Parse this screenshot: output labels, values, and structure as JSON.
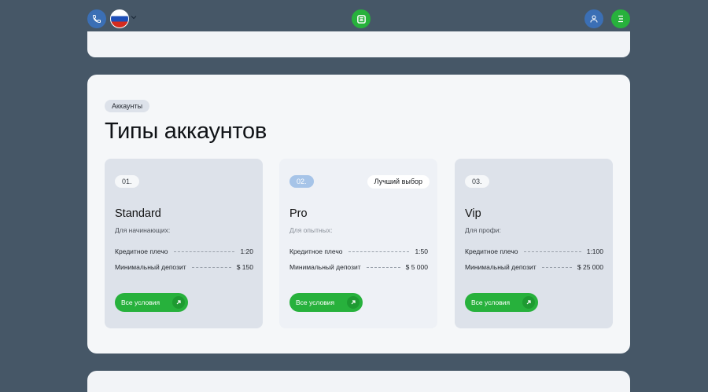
{
  "header": {
    "phone_icon": "phone-icon",
    "flag_icon": "russia-flag-icon",
    "logo_icon": "brand-logo-icon",
    "user_icon": "user-icon",
    "menu_icon": "menu-icon",
    "brand_color": "#27b13c",
    "accent_color": "#3b6fb5"
  },
  "section": {
    "badge": "Аккаунты",
    "title": "Типы аккаунтов"
  },
  "plans": [
    {
      "number": "01.",
      "best_label": "",
      "name": "Standard",
      "audience": "Для начинающих:",
      "leverage_label": "Кредитное плечо",
      "leverage_value": "1:20",
      "deposit_label": "Минимальный депозит",
      "deposit_value": "$ 150",
      "cta": "Все условия"
    },
    {
      "number": "02.",
      "best_label": "Лучший выбор",
      "name": "Pro",
      "audience": "Для опытных:",
      "leverage_label": "Кредитное плечо",
      "leverage_value": "1:50",
      "deposit_label": "Минимальный депозит",
      "deposit_value": "$ 5 000",
      "cta": "Все условия"
    },
    {
      "number": "03.",
      "best_label": "",
      "name": "Vip",
      "audience": "Для профи:",
      "leverage_label": "Кредитное плечо",
      "leverage_value": "1:100",
      "deposit_label": "Минимальный депозит",
      "deposit_value": "$ 25 000",
      "cta": "Все условия"
    }
  ]
}
